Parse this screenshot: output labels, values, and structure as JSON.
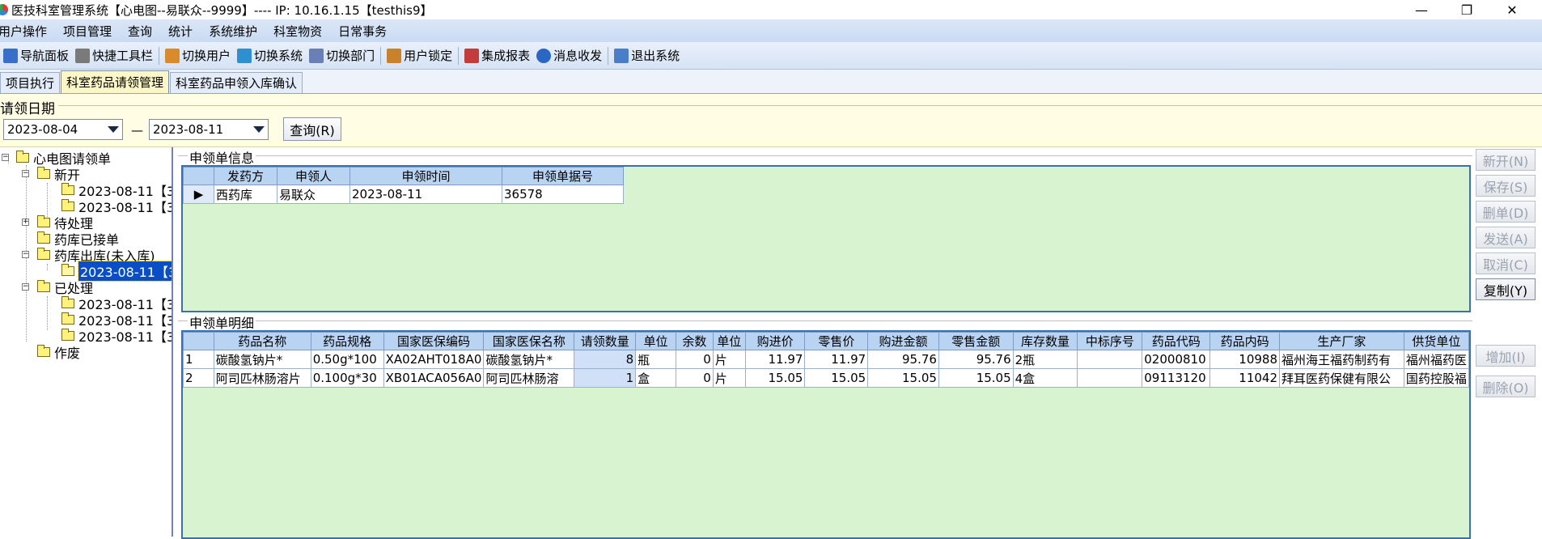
{
  "window": {
    "title": "医技科室管理系统【心电图--易联众--9999】---- IP:  10.16.1.15【testhis9】",
    "controls": {
      "minimize": "—",
      "restore": "❐",
      "close": "✕"
    }
  },
  "menu": [
    "用户操作",
    "项目管理",
    "查询",
    "统计",
    "系统维护",
    "科室物资",
    "日常事务"
  ],
  "toolbar": [
    {
      "label": "导航面板",
      "icon": "navigation-panel-icon",
      "color": "#3a6fc9"
    },
    {
      "label": "快捷工具栏",
      "icon": "tools-icon",
      "color": "#7a7a7a"
    },
    {
      "label": "切换用户",
      "icon": "switch-user-icon",
      "color": "#d98b2b"
    },
    {
      "label": "切换系统",
      "icon": "switch-system-icon",
      "color": "#2f8fd0"
    },
    {
      "label": "切换部门",
      "icon": "switch-department-icon",
      "color": "#6a7fb8"
    },
    {
      "label": "用户锁定",
      "icon": "user-lock-icon",
      "color": "#c9812a"
    },
    {
      "label": "集成报表",
      "icon": "report-icon",
      "color": "#c33b3b"
    },
    {
      "label": "消息收发",
      "icon": "message-icon",
      "color": "#2a66c4"
    },
    {
      "label": "退出系统",
      "icon": "exit-icon",
      "color": "#4a7ec8"
    }
  ],
  "tabs": [
    "项目执行",
    "科室药品请领管理",
    "科室药品申领入库确认"
  ],
  "active_tab": 1,
  "date_filter": {
    "legend": "请领日期",
    "start": "2023-08-04",
    "separator": "—",
    "end": "2023-08-11",
    "query_button": "查询(R)"
  },
  "tree": {
    "root": "心电图请领单",
    "nodes": {
      "new": "新开",
      "new_1": "2023-08-11【3",
      "new_2": "2023-08-11【3",
      "pending": "待处理",
      "received": "药库已接单",
      "outbound": "药库出库(未入库)",
      "outbound_1": "2023-08-11【3",
      "processed": "已处理",
      "processed_1": "2023-08-11【3",
      "processed_2": "2023-08-11【3",
      "processed_3": "2023-08-11【3",
      "void": "作废"
    }
  },
  "request_info": {
    "legend": "申领单信息",
    "columns": [
      "发药方",
      "申领人",
      "申领时间",
      "申领单据号"
    ],
    "rows": [
      [
        "西药库",
        "易联众",
        "2023-08-11",
        "36578"
      ]
    ]
  },
  "detail": {
    "legend": "申领单明细",
    "columns": [
      "药品名称",
      "药品规格",
      "国家医保编码",
      "国家医保名称",
      "请领数量",
      "单位",
      "余数",
      "单位",
      "购进价",
      "零售价",
      "购进金额",
      "零售金额",
      "库存数量",
      "中标序号",
      "药品代码",
      "药品内码",
      "生产厂家",
      "供货单位"
    ],
    "rows": [
      [
        "1",
        "碳酸氢钠片*",
        "0.50g*100",
        "XA02AHT018A0",
        "碳酸氢钠片*",
        "8",
        "瓶",
        "0",
        "片",
        "11.97",
        "11.97",
        "95.76",
        "95.76",
        "2瓶",
        "",
        "02000810",
        "10988",
        "福州海王福药制药有",
        "福州福药医"
      ],
      [
        "2",
        "阿司匹林肠溶片",
        "0.100g*30",
        "XB01ACA056A0",
        "阿司匹林肠溶",
        "1",
        "盒",
        "0",
        "片",
        "15.05",
        "15.05",
        "15.05",
        "15.05",
        "4盒",
        "",
        "09113120",
        "11042",
        "拜耳医药保健有限公",
        "国药控股福"
      ]
    ]
  },
  "side_buttons": {
    "new": "新开(N)",
    "save": "保存(S)",
    "delete": "删单(D)",
    "send": "发送(A)",
    "cancel": "取消(C)",
    "copy": "复制(Y)",
    "add": "增加(I)",
    "remove": "删除(O)"
  }
}
